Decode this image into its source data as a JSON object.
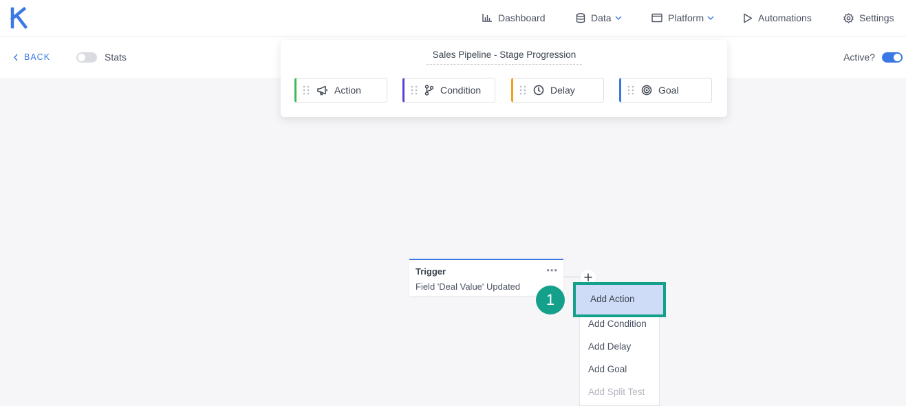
{
  "app": {
    "logo_letter": "K"
  },
  "nav": {
    "dashboard": "Dashboard",
    "data": "Data",
    "platform": "Platform",
    "automations": "Automations",
    "settings": "Settings"
  },
  "subheader": {
    "back_label": "BACK",
    "stats_label": "Stats",
    "stats_enabled": false,
    "active_label": "Active?",
    "active_enabled": true
  },
  "palette": {
    "flow_name": "Sales Pipeline - Stage Progression",
    "blocks": [
      {
        "label": "Action",
        "icon": "megaphone-icon",
        "color": "#3fba5a"
      },
      {
        "label": "Condition",
        "icon": "branch-icon",
        "color": "#5b3fd6"
      },
      {
        "label": "Delay",
        "icon": "clock-icon",
        "color": "#f0a020"
      },
      {
        "label": "Goal",
        "icon": "target-icon",
        "color": "#3a78e6"
      }
    ]
  },
  "trigger": {
    "title": "Trigger",
    "description": "Field 'Deal Value' Updated",
    "more": "•••"
  },
  "add_menu": {
    "items": [
      "Add Action",
      "Add Condition",
      "Add Delay",
      "Add Goal",
      "Add Split Test"
    ],
    "highlighted": "Add Action",
    "disabled": [
      "Add Split Test"
    ]
  },
  "annotation": {
    "step_number": "1",
    "color": "#14a08a"
  },
  "colors": {
    "accent": "#3a78e6",
    "highlight": "#14a08a",
    "background": "#f6f6f8"
  }
}
